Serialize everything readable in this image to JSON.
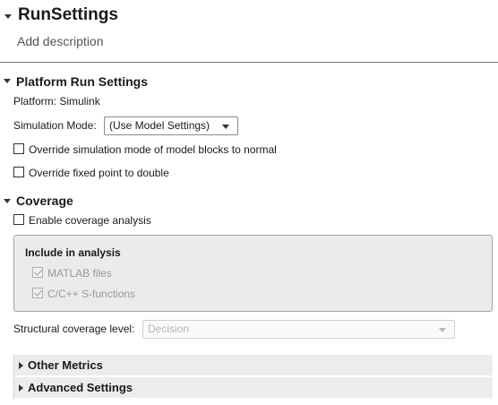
{
  "header": {
    "title": "RunSettings",
    "description_placeholder": "Add description"
  },
  "platform_section": {
    "title": "Platform Run Settings",
    "platform_label": "Platform: Simulink",
    "simulation_mode_label": "Simulation Mode:",
    "simulation_mode_value": "(Use Model Settings)",
    "override_sim_mode_label": "Override simulation mode of model blocks to normal",
    "override_sim_mode_checked": false,
    "override_fixed_point_label": "Override fixed point to double",
    "override_fixed_point_checked": false
  },
  "coverage_section": {
    "title": "Coverage",
    "enable_label": "Enable coverage analysis",
    "enable_checked": false,
    "include_group": {
      "title": "Include in analysis",
      "matlab_files_label": "MATLAB files",
      "matlab_files_checked": true,
      "sfunctions_label": "C/C++ S-functions",
      "sfunctions_checked": true
    },
    "structural_level_label": "Structural coverage level:",
    "structural_level_value": "Decision"
  },
  "collapsed_sections": {
    "other_metrics": "Other Metrics",
    "advanced_settings": "Advanced Settings"
  },
  "icons": {
    "expanded": "caret-down-icon",
    "collapsed": "caret-right-icon",
    "dropdown": "chevron-down-icon",
    "checkmark": "checkmark-icon"
  }
}
